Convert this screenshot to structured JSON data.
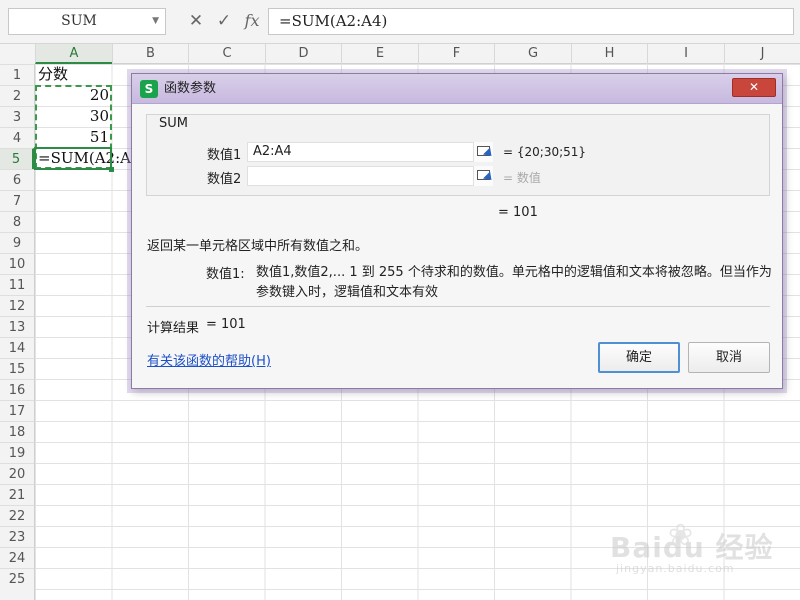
{
  "formula_bar": {
    "name_box": "SUM",
    "cancel_icon": "close-x",
    "confirm_icon": "check",
    "fx_label": "fx",
    "formula": "=SUM(A2:A4)"
  },
  "sheet": {
    "columns": [
      "A",
      "B",
      "C",
      "D",
      "E",
      "F",
      "G",
      "H",
      "I",
      "J"
    ],
    "rows": [
      "1",
      "2",
      "3",
      "4",
      "5",
      "6",
      "7",
      "8",
      "9",
      "10",
      "11",
      "12",
      "13",
      "14",
      "15",
      "16",
      "17",
      "18",
      "19",
      "20",
      "21",
      "22",
      "23",
      "24",
      "25"
    ],
    "cells": {
      "A1": "分数",
      "A2": "20",
      "A3": "30",
      "A4": "51",
      "A5": "=SUM(A2:A4)"
    }
  },
  "dialog": {
    "app_icon_letter": "S",
    "title": "函数参数",
    "close_symbol": "✕",
    "function_name": "SUM",
    "arg1_label": "数值1",
    "arg1_value": "A2:A4",
    "arg1_result": "= {20;30;51}",
    "arg2_label": "数值2",
    "arg2_value": "",
    "arg2_result": "= 数值",
    "total": "= 101",
    "description": "返回某一单元格区域中所有数值之和。",
    "param_name": "数值1:",
    "param_description": "数值1,数值2,... 1 到 255 个待求和的数值。单元格中的逻辑值和文本将被忽略。但当作为参数键入时，逻辑值和文本有效",
    "calc_label": "计算结果",
    "calc_eq": "=",
    "calc_value": "101",
    "help_link": "有关该函数的帮助(H)",
    "ok_label": "确定",
    "cancel_label": "取消"
  },
  "watermark": {
    "brand": "Baidu 经验",
    "url": "jingyan.baidu.com"
  },
  "colors": {
    "accent_green": "#2e8b46",
    "dialog_title": "#c7b9df",
    "close_red": "#c9463c",
    "link_blue": "#1d50c8"
  }
}
